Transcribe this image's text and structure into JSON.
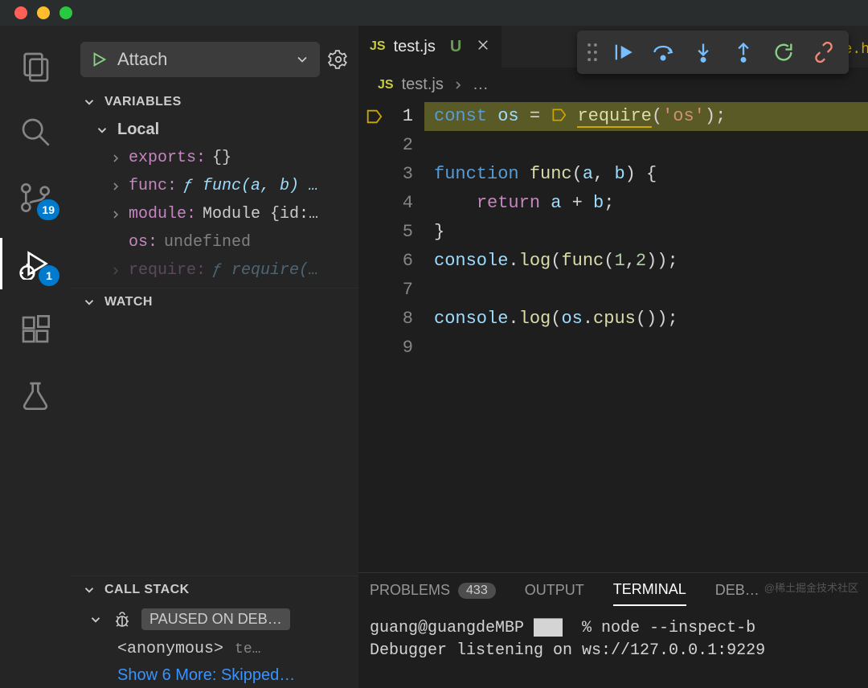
{
  "traffic_lights": [
    "close",
    "minimize",
    "maximize"
  ],
  "activity": {
    "items": [
      "explorer",
      "search",
      "source-control",
      "run-debug",
      "extensions",
      "testing"
    ],
    "scm_badge": "19",
    "debug_badge": "1",
    "active": "run-debug"
  },
  "debug": {
    "config_name": "Attach",
    "sections": {
      "variables": "VARIABLES",
      "watch": "WATCH",
      "callstack": "CALL STACK"
    },
    "scope": "Local",
    "vars": [
      {
        "name": "exports:",
        "value": "{}",
        "kind": "obj",
        "expandable": true
      },
      {
        "name": "func:",
        "value": "ƒ func(a, b) …",
        "kind": "fn",
        "expandable": true
      },
      {
        "name": "module:",
        "value": "Module {id:…",
        "kind": "obj",
        "expandable": true
      },
      {
        "name": "os:",
        "value": "undefined",
        "kind": "undef",
        "expandable": false
      },
      {
        "name": "require:",
        "value": "ƒ require(…",
        "kind": "fn",
        "expandable": true
      }
    ],
    "callstack": {
      "paused_label": "PAUSED ON DEB…",
      "frame_name": "<anonymous>",
      "frame_file": "te…",
      "more": "Show 6 More: Skipped…"
    }
  },
  "tabs": [
    {
      "icon": "JS",
      "name": "test.js",
      "git": "U",
      "active": true
    }
  ],
  "breadcrumb": {
    "icon": "JS",
    "file": "test.js",
    "rest": "…"
  },
  "peek_behind": "e.h",
  "code_lines": 9,
  "panel": {
    "tabs": [
      "PROBLEMS",
      "OUTPUT",
      "TERMINAL",
      "DEB…"
    ],
    "problems_count": "433",
    "active_tab": "TERMINAL",
    "terminal_lines": [
      "guang@guangdeMBP ███  % node --inspect-b",
      "Debugger listening on ws://127.0.0.1:9229"
    ]
  },
  "watermark": "@稀土掘金技术社区"
}
